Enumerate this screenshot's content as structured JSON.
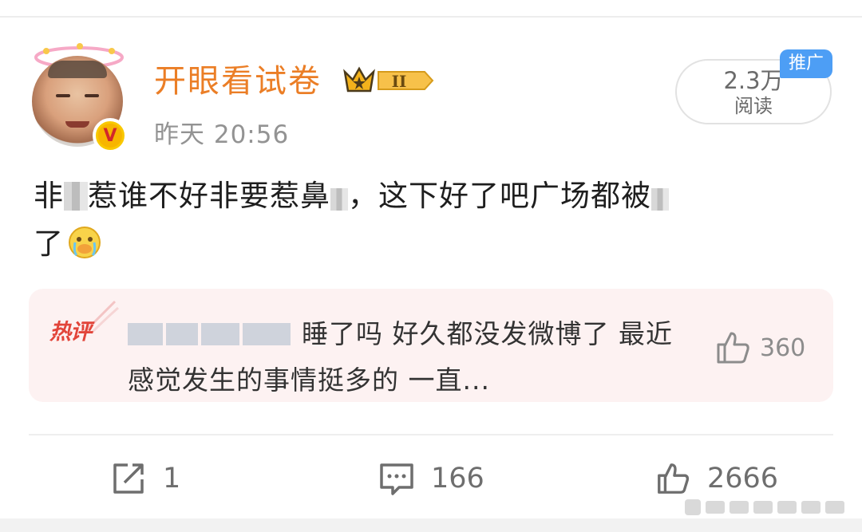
{
  "post": {
    "username": "开眼看试卷",
    "timestamp": "昨天 20:56",
    "read_count": "2.3万",
    "read_label": "阅读",
    "promo_tag": "推广",
    "text_part1": "非",
    "text_part2": "惹谁不好非要惹鼻",
    "text_part3": "，这下好了吧广场都被",
    "text_part4": "了"
  },
  "hot_comment": {
    "tag": "热评",
    "text": "睡了吗 好久都没发微博了 最近感觉发生的事情挺多的 一直...",
    "like_count": "360"
  },
  "actions": {
    "repost_count": "1",
    "comment_count": "166",
    "like_count": "2666"
  },
  "icons": {
    "verified": "verified-badge-icon",
    "crown": "crown-level-icon",
    "repost": "repost-icon",
    "comment": "comment-icon",
    "like": "like-icon",
    "emoji": "crying-face-emoji-icon"
  },
  "colors": {
    "username": "#eb7e26",
    "promo": "#4d9ef5",
    "hot_tag": "#e2453a",
    "hot_bg": "#fdf2f2"
  }
}
